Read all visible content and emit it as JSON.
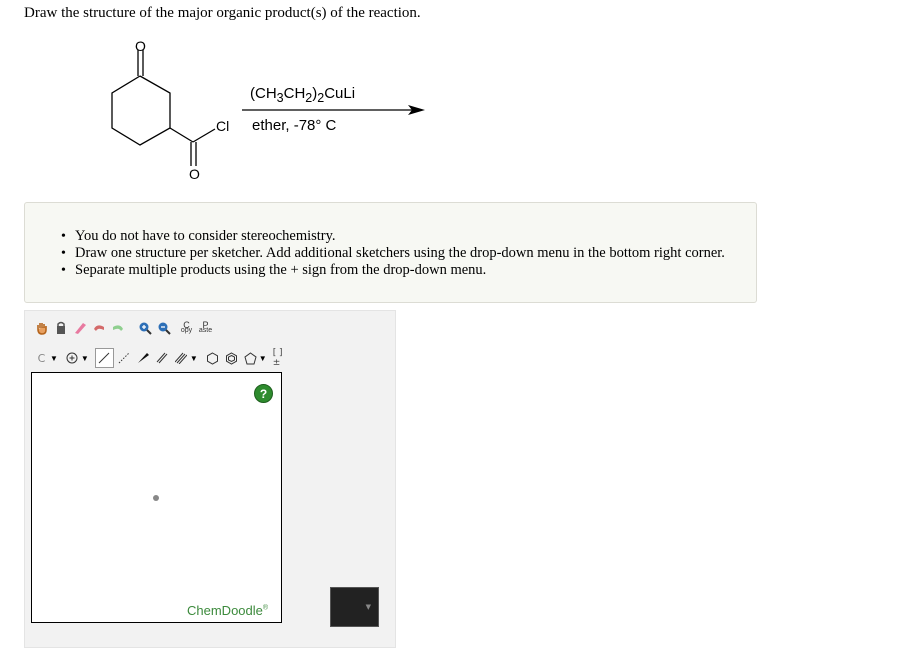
{
  "question": "Draw the structure of the major organic product(s) of the reaction.",
  "reaction": {
    "reagent_top": "(CH3CH2)2CuLi",
    "reagent_bottom": "ether, -78° C",
    "atoms": {
      "o_top": "O",
      "o_bottom": "O",
      "cl": "Cl"
    }
  },
  "notes": [
    "You do not have to consider stereochemistry.",
    "Draw one structure per sketcher. Add additional sketchers using the drop-down menu in the bottom right corner.",
    "Separate multiple products using the + sign from the drop-down menu."
  ],
  "toolbar": {
    "row1_icons": [
      "hand-icon",
      "lasso-icon",
      "eraser-icon",
      "undo-icon",
      "redo-icon",
      "zoom-in-icon",
      "zoom-out-icon",
      "copy-icon",
      "paste-icon"
    ],
    "copy": {
      "top": "C",
      "bottom": "opy"
    },
    "paste": {
      "top": "P",
      "bottom": "aste"
    },
    "atom_label": "C",
    "bracket_label": "[ ]±"
  },
  "sketcher": {
    "help": "?",
    "brand": "ChemDoodle",
    "brand_mark": "®"
  },
  "colors": {
    "help_green": "#2e8b2e",
    "brand_green": "#3c8a3c",
    "add_button": "#222222"
  }
}
